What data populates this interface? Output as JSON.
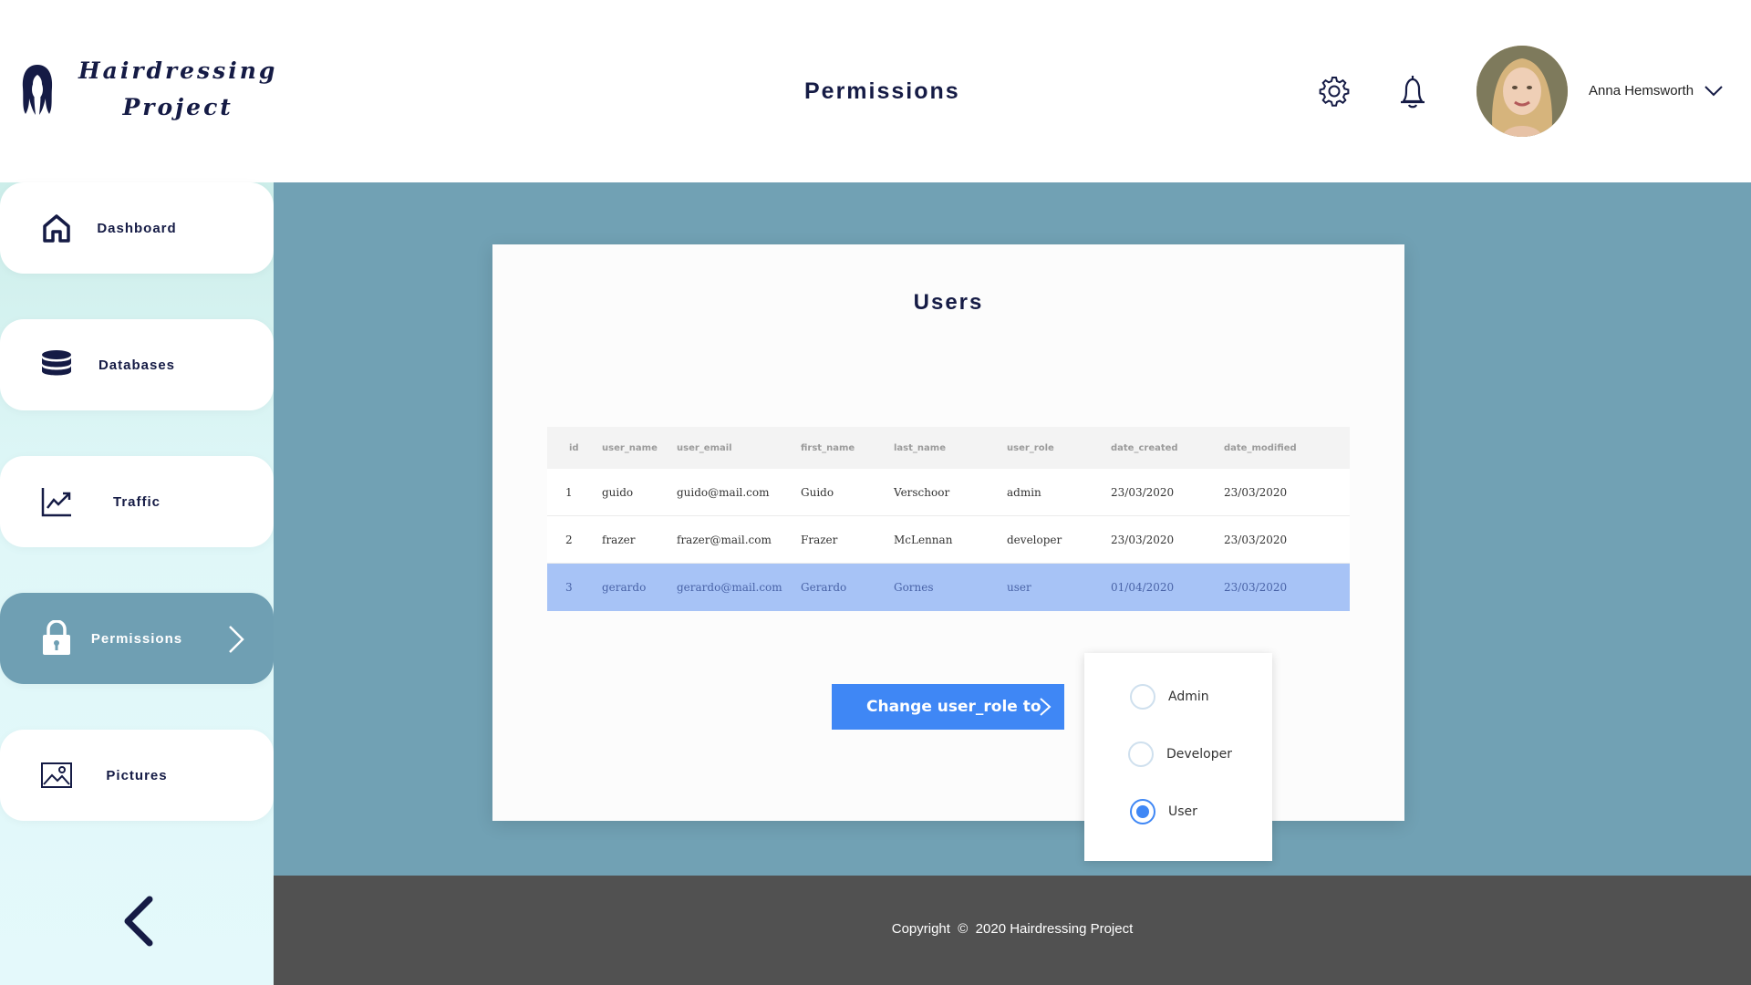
{
  "app": {
    "logo_line1": "Hairdressing",
    "logo_line2": "Project",
    "page_title": "Permissions"
  },
  "header": {
    "icons": [
      "gear-icon",
      "bell-icon"
    ],
    "user_name": "Anna Hemsworth"
  },
  "sidebar": {
    "items": [
      {
        "label": "Dashboard",
        "icon": "home-icon"
      },
      {
        "label": "Databases",
        "icon": "database-icon"
      },
      {
        "label": "Traffic",
        "icon": "chart-icon"
      },
      {
        "label": "Permissions",
        "icon": "lock-icon",
        "active": true
      },
      {
        "label": "Pictures",
        "icon": "image-icon"
      }
    ]
  },
  "main": {
    "card_title": "Users",
    "table": {
      "columns": [
        "id",
        "user_name",
        "user_email",
        "first_name",
        "last_name",
        "user_role",
        "date_created",
        "date_modified"
      ],
      "rows": [
        [
          "1",
          "guido",
          "guido@mail.com",
          "Guido",
          "Verschoor",
          "admin",
          "23/03/2020",
          "23/03/2020"
        ],
        [
          "2",
          "frazer",
          "frazer@mail.com",
          "Frazer",
          "McLennan",
          "developer",
          "23/03/2020",
          "23/03/2020"
        ],
        [
          "3",
          "gerardo",
          "gerardo@mail.com",
          "Gerardo",
          "Gornes",
          "user",
          "01/04/2020",
          "23/03/2020"
        ]
      ],
      "selected_row": "3"
    },
    "change_button": "Change user_role to",
    "roles": [
      {
        "label": "Admin",
        "checked": false
      },
      {
        "label": "Developer",
        "checked": false
      },
      {
        "label": "User",
        "checked": true
      }
    ]
  },
  "footer": {
    "copyright_prefix": "Copyright",
    "copyright_text": "2020 Hairdressing Project"
  },
  "colors": {
    "navy": "#151b45",
    "main_bg": "#71a1b4",
    "active_nav": "#6f9fb3",
    "accent_blue": "#3f87f5",
    "selected_row": "#a7c3f6",
    "footer_bg": "#515151"
  }
}
